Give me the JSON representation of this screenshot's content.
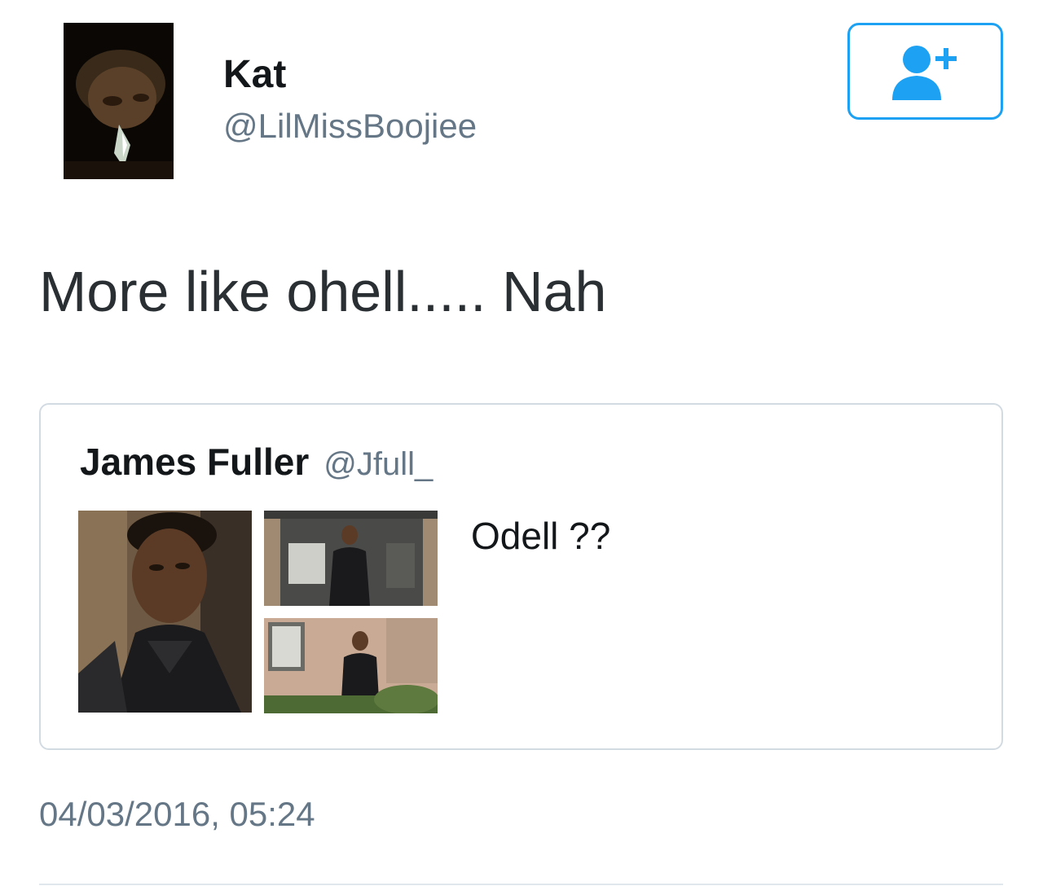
{
  "author": {
    "display_name": "Kat",
    "handle": "@LilMissBoojiee",
    "avatar_icon": "profile-photo"
  },
  "follow_button": {
    "icon": "add-user-icon",
    "accent_color": "#1da1f2"
  },
  "tweet": {
    "text": "More like ohell..... Nah",
    "timestamp": "04/03/2016, 05:24"
  },
  "quoted_tweet": {
    "display_name": "James Fuller",
    "handle": "@Jfull_",
    "text": "Odell ??",
    "media_count": 3
  },
  "colors": {
    "text_primary": "#14171a",
    "text_secondary": "#657786",
    "border": "#d3dbe2",
    "accent": "#1da1f2"
  }
}
